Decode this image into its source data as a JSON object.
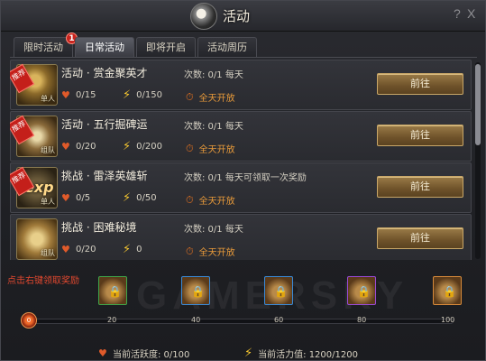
{
  "window": {
    "title": "活动",
    "help": "?",
    "close": "X"
  },
  "tabs": [
    {
      "label": "限时活动",
      "badge": "1"
    },
    {
      "label": "日常活动"
    },
    {
      "label": "即将开启"
    },
    {
      "label": "活动周历"
    }
  ],
  "activities": [
    {
      "name": "活动 · 赏金聚英才",
      "count": "次数: 0/1 每天",
      "vitality": "0/15",
      "energy": "0/150",
      "time": "全天开放",
      "button": "前往",
      "ribbon": "推荐",
      "icon_sub": "单人",
      "icon": "gold-pile-icon"
    },
    {
      "name": "活动 · 五行掘碑运",
      "count": "次数: 0/1 每天",
      "vitality": "0/20",
      "energy": "0/200",
      "time": "全天开放",
      "button": "前往",
      "ribbon": "推荐",
      "icon_sub": "组队",
      "icon": "crossed-swords-icon"
    },
    {
      "name": "挑战 · 雷泽英雄斩",
      "count": "次数: 0/1 每天可领取一次奖励",
      "vitality": "0/5",
      "energy": "0/50",
      "time": "全天开放",
      "button": "前往",
      "ribbon": "推荐",
      "icon_sub": "单人",
      "icon": "exp-icon",
      "icon_text": "exp"
    },
    {
      "name": "挑战 · 困难秘境",
      "count": "次数: 0/1 每天",
      "vitality": "0/20",
      "energy": "0",
      "time": "全天开放",
      "button": "前往",
      "icon_sub": "组队",
      "icon": "scroll-icon"
    }
  ],
  "rewards": {
    "hint": "点击右键领取奖励",
    "current_progress": "0",
    "milestones": [
      "20",
      "40",
      "60",
      "80",
      "100"
    ],
    "progress_fraction": 0
  },
  "footer": {
    "vitality_label": "当前活跃度: 0/100",
    "energy_label": "当前活力值: 1200/1200"
  },
  "watermark": "GAMERSKY",
  "colors": {
    "accent_gold": "#c9a768",
    "badge_red": "#c8241e",
    "hint_red": "#e2482f"
  }
}
